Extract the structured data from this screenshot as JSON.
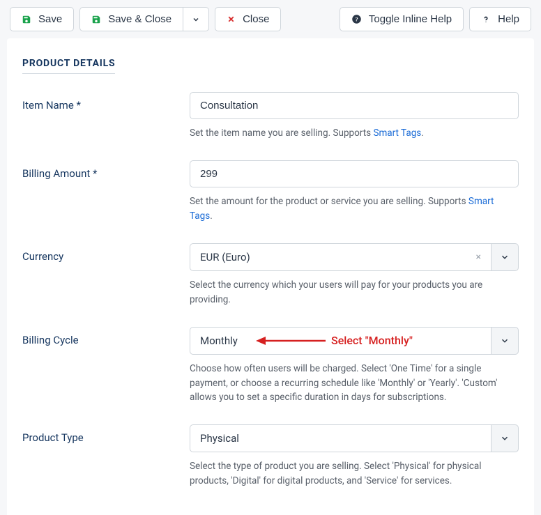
{
  "toolbar": {
    "save": "Save",
    "save_close": "Save & Close",
    "close": "Close",
    "toggle_help": "Toggle Inline Help",
    "help": "Help"
  },
  "section_title": "PRODUCT DETAILS",
  "fields": {
    "item_name": {
      "label": "Item Name *",
      "value": "Consultation",
      "help_pre": "Set the item name you are selling. Supports ",
      "help_link": "Smart Tags",
      "help_post": "."
    },
    "billing_amount": {
      "label": "Billing Amount *",
      "value": "299",
      "help_pre": "Set the amount for the product or service you are selling. Supports ",
      "help_link": "Smart Tags",
      "help_post": "."
    },
    "currency": {
      "label": "Currency",
      "value": "EUR (Euro)",
      "help": "Select the currency which your users will pay for your products you are providing."
    },
    "billing_cycle": {
      "label": "Billing Cycle",
      "value": "Monthly",
      "help": "Choose how often users will be charged. Select 'One Time' for a single payment, or choose a recurring schedule like 'Monthly' or 'Yearly'. 'Custom' allows you to set a specific duration in days for subscriptions."
    },
    "product_type": {
      "label": "Product Type",
      "value": "Physical",
      "help": "Select the type of product you are selling. Select 'Physical' for physical products, 'Digital' for digital products, and 'Service' for services."
    }
  },
  "annotation": "Select \"Monthly\""
}
